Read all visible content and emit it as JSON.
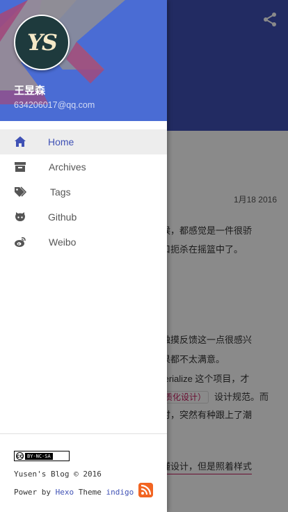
{
  "drawer": {
    "avatar_text": "YS",
    "user_name": "王昱森",
    "user_email": "634206017@qq.com",
    "menu": [
      {
        "label": "Home",
        "icon": "home-icon",
        "active": true
      },
      {
        "label": "Archives",
        "icon": "archive-icon",
        "active": false
      },
      {
        "label": "Tags",
        "icon": "tags-icon",
        "active": false
      },
      {
        "label": "Github",
        "icon": "github-icon",
        "active": false
      },
      {
        "label": "Weibo",
        "icon": "weibo-icon",
        "active": false
      }
    ],
    "footer": {
      "license_badge": "BY-NC-SA",
      "license_cc": "cc",
      "copyright": "Yusen's Blog © 2016",
      "power_prefix": "Power by",
      "power_hexo": "Hexo",
      "power_theme": "Theme",
      "power_indigo": "indigo"
    }
  },
  "background_page": {
    "date": "1月18 2016",
    "lines": [
      "候，都感觉是一件很骄",
      "口扼杀在摇篮中了。",
      "触摸反馈这一点很感兴",
      "果都不太满意。",
      "terialize 这个项目，才",
      "设计规范。而",
      "时，突然有种跟上了潮",
      "懂设计，但是照着样式"
    ],
    "tag_text": "质化设计）"
  },
  "colors": {
    "primary": "#3f51b5",
    "rss": "#f26522",
    "link_underline": "#c2185b"
  }
}
